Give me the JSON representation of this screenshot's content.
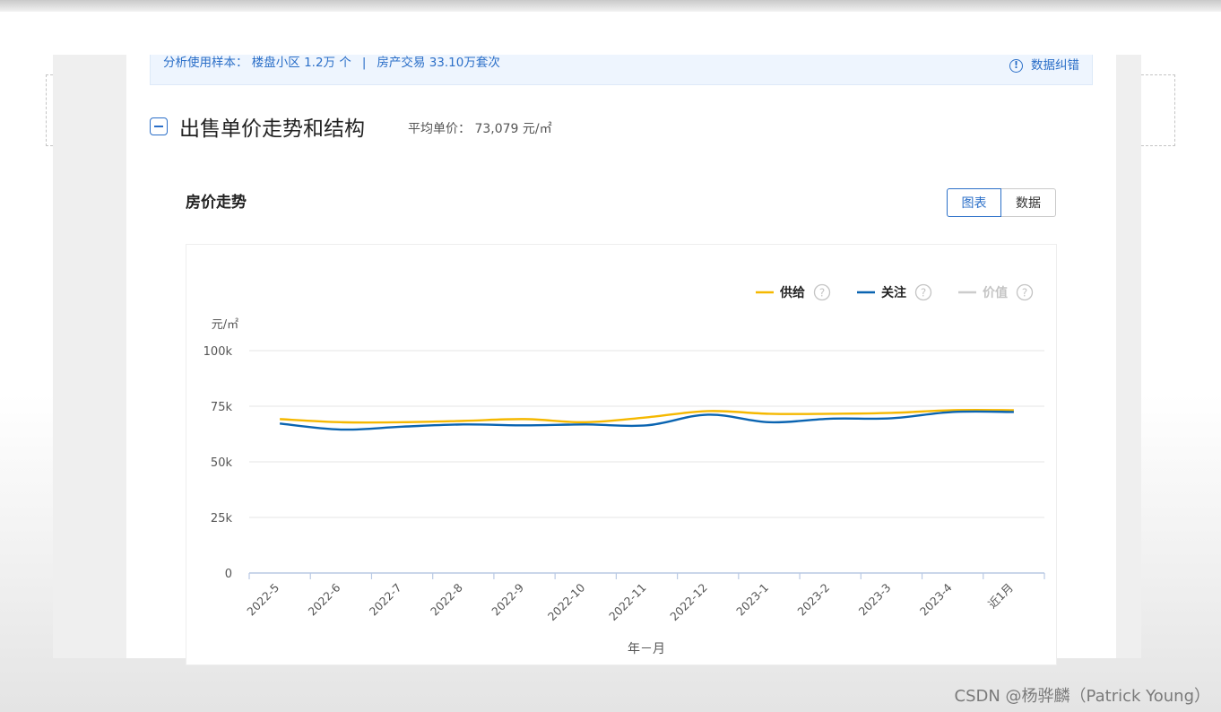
{
  "info_bar": {
    "sample_label": "分析使用样本：",
    "community_count": "楼盘小区 1.2万 个",
    "separator": "|",
    "transaction_count": "房产交易 33.10万套次",
    "correction_label": "数据纠错",
    "correction_icon": "info-icon"
  },
  "section": {
    "title": "出售单价走势和结构",
    "avg_price": "平均单价：  73,079 元/㎡"
  },
  "chart_card": {
    "title": "房价走势",
    "toggle": {
      "chart_label": "图表",
      "data_label": "数据",
      "active": "图表"
    }
  },
  "chart_data": {
    "type": "line",
    "categories": [
      "2022-5",
      "2022-6",
      "2022-7",
      "2022-8",
      "2022-9",
      "2022-10",
      "2022-11",
      "2022-12",
      "2023-1",
      "2023-2",
      "2023-3",
      "2023-4",
      "近1月"
    ],
    "series": [
      {
        "name": "供给",
        "color": "#f5b800",
        "visible": true,
        "values": [
          69200,
          67800,
          67800,
          68400,
          69200,
          67800,
          70000,
          72800,
          71600,
          71600,
          72000,
          73200,
          73200
        ]
      },
      {
        "name": "关注",
        "color": "#0a64b1",
        "visible": true,
        "values": [
          67200,
          64500,
          65800,
          66800,
          66400,
          66800,
          66400,
          71200,
          67800,
          69400,
          69600,
          72400,
          72400
        ]
      },
      {
        "name": "价值",
        "color": "#cccccc",
        "visible": false,
        "values": []
      }
    ],
    "legend_help_icon": "question-circle-icon",
    "legend_position": "top-right",
    "ylabel": "元/㎡",
    "xlabel": "年－月",
    "yticks": [
      "0",
      "25k",
      "50k",
      "75k",
      "100k"
    ],
    "ylim": [
      0,
      100000
    ],
    "grid": true
  },
  "watermark": "CSDN @杨骅麟（Patrick Young）"
}
